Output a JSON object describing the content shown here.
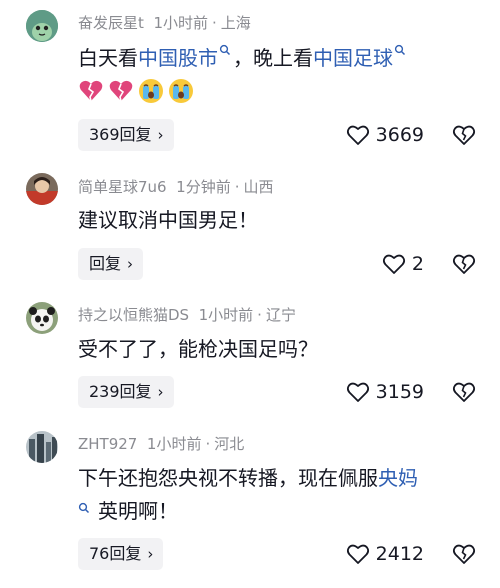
{
  "comments": [
    {
      "user": "奋发辰星t",
      "time": "1小时前",
      "location": "上海",
      "text_pre": "白天看",
      "link1": "中国股市",
      "text_mid": "，晚上看",
      "link2": "中国足球",
      "emojis": [
        "broken-heart-icon",
        "broken-heart-icon",
        "crying-face-icon",
        "crying-face-icon"
      ],
      "reply_label": "369回复",
      "likes": "3669"
    },
    {
      "user": "简单星球7u6",
      "time": "1分钟前",
      "location": "山西",
      "text": "建议取消中国男足！",
      "reply_label": "回复",
      "likes": "2"
    },
    {
      "user": "持之以恒熊猫DS",
      "time": "1小时前",
      "location": "辽宁",
      "text": "受不了了，能枪决国足吗？",
      "reply_label": "239回复",
      "likes": "3159"
    },
    {
      "user": "ZHT927",
      "time": "1小时前",
      "location": "河北",
      "text_pre": "下午还抱怨央视不转播，现在佩服",
      "link1": "央妈",
      "text_post": "英明啊！",
      "reply_label": "76回复",
      "likes": "2412"
    }
  ],
  "colors": {
    "link": "#2f5fb3",
    "meta": "#8a8b91",
    "reply_bg": "#f2f2f4"
  },
  "icons": {
    "separator": "·",
    "chevron": "›"
  }
}
